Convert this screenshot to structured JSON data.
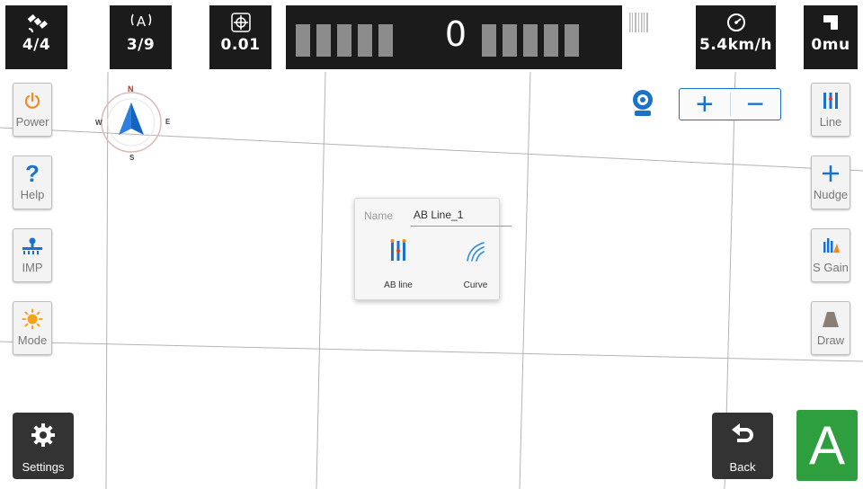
{
  "status_bar": {
    "satellites_used": "4/4",
    "satellites_visible": "3/9",
    "precision": "0.01",
    "lightbar_offset": "0",
    "speed": "5.4km/h",
    "area": "0mu",
    "icons": {
      "satellite": "satellite-icon",
      "antenna": "antenna-icon",
      "precision": "crosshair-icon",
      "barcode": "barcode-icon",
      "speed": "speedometer-icon",
      "area": "area-icon"
    }
  },
  "left_toolbar": {
    "power": "Power",
    "help": "Help",
    "imp": "IMP",
    "mode": "Mode",
    "settings": "Settings"
  },
  "right_toolbar": {
    "line": "Line",
    "nudge": "Nudge",
    "s_gain": "S Gain",
    "draw": "Draw",
    "back": "Back",
    "auto": "A"
  },
  "compass": {
    "n": "N",
    "s": "S",
    "e": "E",
    "w": "W"
  },
  "zoom": {
    "plus": "+",
    "minus": "−"
  },
  "line_dialog": {
    "name_label": "Name",
    "name_value": "AB Line_1",
    "option_ab": "AB line",
    "option_curve": "Curve"
  },
  "colors": {
    "accent_blue": "#1a73c8",
    "auto_green": "#2e9e3f",
    "power_orange": "#f08a24",
    "status_bg": "#1b1b1b"
  }
}
